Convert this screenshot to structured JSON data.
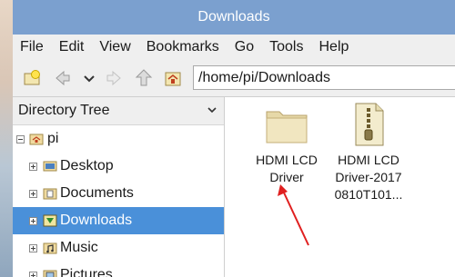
{
  "window": {
    "title": "Downloads"
  },
  "menubar": {
    "items": [
      "File",
      "Edit",
      "View",
      "Bookmarks",
      "Go",
      "Tools",
      "Help"
    ]
  },
  "toolbar": {
    "path_value": "/home/pi/Downloads",
    "icons": [
      "new-tab-icon",
      "back-icon",
      "history-dropdown-icon",
      "forward-icon",
      "up-icon",
      "home-icon"
    ]
  },
  "sidebar": {
    "header_label": "Directory Tree",
    "items": [
      {
        "label": "pi",
        "expander": "minus",
        "icon": "home-folder-icon"
      },
      {
        "label": "Desktop",
        "expander": "plus",
        "icon": "desktop-icon"
      },
      {
        "label": "Documents",
        "expander": "plus",
        "icon": "documents-icon"
      },
      {
        "label": "Downloads",
        "expander": "plus",
        "icon": "downloads-icon",
        "selected": true
      },
      {
        "label": "Music",
        "expander": "plus",
        "icon": "music-icon"
      },
      {
        "label": "Pictures",
        "expander": "plus",
        "icon": "pictures-icon"
      }
    ]
  },
  "files": [
    {
      "name_line1": "HDMI LCD",
      "name_line2": "Driver",
      "name_line3": "",
      "icon": "folder-icon"
    },
    {
      "name_line1": "HDMI LCD",
      "name_line2": "Driver-2017",
      "name_line3": "0810T101...",
      "icon": "zip-archive-icon"
    }
  ],
  "colors": {
    "titlebar": "#7ba0cf",
    "selection": "#4a90d9",
    "annotation_arrow": "#e02020"
  }
}
